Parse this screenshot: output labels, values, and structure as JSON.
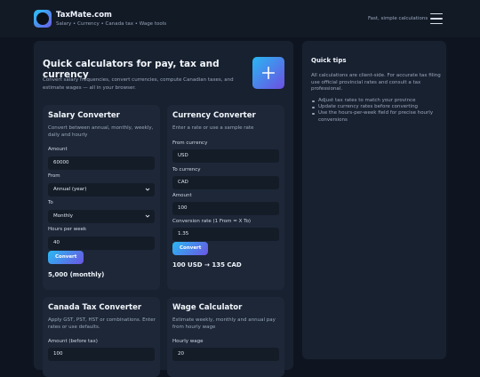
{
  "header": {
    "brand_title": "TaxMate.com",
    "brand_sub": "Salary • Currency • Canada tax • Wage tools",
    "tagline": "Fast, simple calculations",
    "logo_icon": "logo-mark-icon",
    "menu_icon": "hamburger-menu-icon"
  },
  "hero": {
    "title": "Quick calculators for pay, tax and currency",
    "subtitle": "Convert salary frequencies, convert currencies, compute Canadian taxes, and estimate wages — all in your browser.",
    "icon": "plus-icon"
  },
  "salary": {
    "title": "Salary Converter",
    "desc": "Convert between annual, monthly, weekly, daily and hourly",
    "amount_label": "Amount",
    "amount_value": "60000",
    "from_label": "From",
    "from_value": "Annual (year)",
    "to_label": "To",
    "to_value": "Monthly",
    "hours_label": "Hours per week",
    "hours_value": "40",
    "button": "Convert",
    "result": "5,000 (monthly)"
  },
  "currency": {
    "title": "Currency Converter",
    "desc": "Enter a rate or use a sample rate",
    "from_label": "From currency",
    "from_value": "USD",
    "to_label": "To currency",
    "to_value": "CAD",
    "amount_label": "Amount",
    "amount_value": "100",
    "rate_label": "Conversion rate (1 From = X To)",
    "rate_value": "1.35",
    "button": "Convert",
    "result": "100 USD → 135 CAD"
  },
  "tax": {
    "title": "Canada Tax Converter",
    "desc": "Apply GST, PST, HST or combinations. Enter rates or use defaults.",
    "amount_label": "Amount (before tax)",
    "amount_value": "100"
  },
  "wage": {
    "title": "Wage Calculator",
    "desc": "Estimate weekly, monthly and annual pay from hourly wage",
    "hourly_label": "Hourly wage",
    "hourly_value": "20"
  },
  "sidebar": {
    "title": "Quick tips",
    "para": "All calculations are client-side. For accurate tax filing use official provincial rates and consult a tax professional.",
    "tips": [
      "Adjust tax rates to match your province",
      "Update currency rates before converting",
      "Use the hours-per-week field for precise hourly conversions"
    ]
  },
  "colors": {
    "accent_start": "#2ab9f2",
    "accent_end": "#6b55e3",
    "page_bg": "#0f1520",
    "panel_bg": "#182130",
    "card_bg": "#1d2737",
    "field_bg": "#141c28"
  }
}
